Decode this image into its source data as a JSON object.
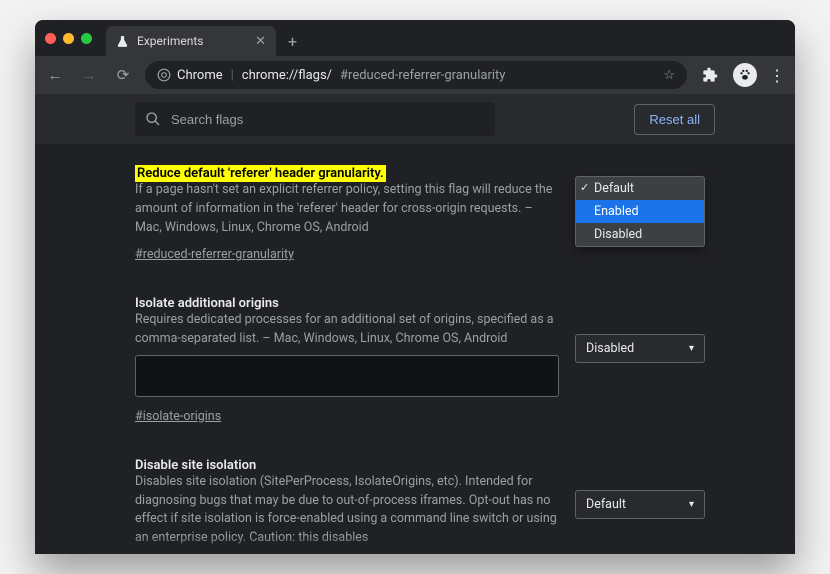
{
  "tab": {
    "title": "Experiments"
  },
  "url": {
    "chip": "Chrome",
    "main": "chrome://flags/",
    "hash": "#reduced-referrer-granularity"
  },
  "topbar": {
    "search_placeholder": "Search flags",
    "reset_label": "Reset all"
  },
  "flags": [
    {
      "title": "Reduce default 'referer' header granularity.",
      "highlight": true,
      "desc": "If a page hasn't set an explicit referrer policy, setting this flag will reduce the amount of information in the 'referer' header for cross-origin requests. – Mac, Windows, Linux, Chrome OS, Android",
      "anchor": "#reduced-referrer-granularity",
      "dropdown": {
        "open": true,
        "options": [
          "Default",
          "Enabled",
          "Disabled"
        ],
        "checked": "Default",
        "highlighted": "Enabled"
      }
    },
    {
      "title": "Isolate additional origins",
      "highlight": false,
      "desc": "Requires dedicated processes for an additional set of origins, specified as a comma-separated list. – Mac, Windows, Linux, Chrome OS, Android",
      "anchor": "#isolate-origins",
      "has_textarea": true,
      "select": {
        "label": "Disabled"
      }
    },
    {
      "title": "Disable site isolation",
      "highlight": false,
      "desc": "Disables site isolation (SitePerProcess, IsolateOrigins, etc). Intended for diagnosing bugs that may be due to out-of-process iframes. Opt-out has no effect if site isolation is force-enabled using a command line switch or using an enterprise policy. Caution: this disables",
      "select": {
        "label": "Default"
      }
    }
  ]
}
